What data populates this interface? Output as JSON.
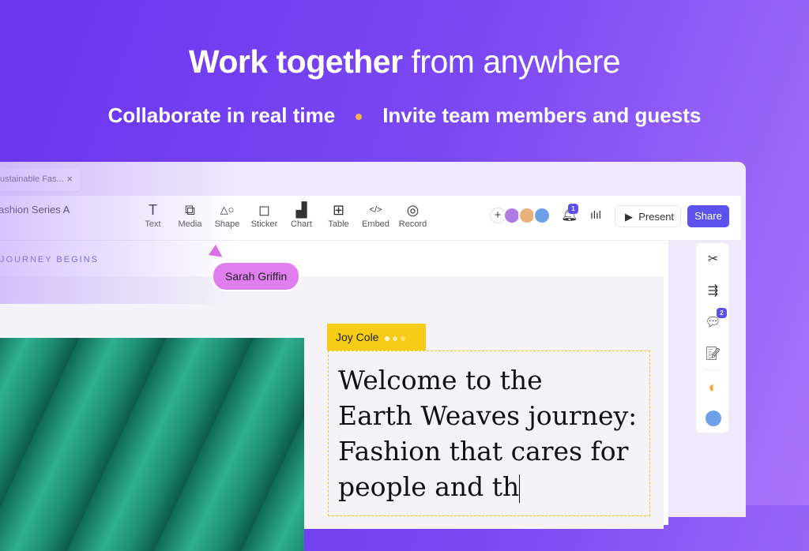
{
  "hero": {
    "title_bold": "Work together",
    "title_light": "from anywhere",
    "sub_left": "Collaborate in real time",
    "sub_right": "Invite team members and guests"
  },
  "tab": {
    "label": "ustainable Fas...",
    "close": "×"
  },
  "doc": {
    "title": "ashion Series A"
  },
  "tools": [
    {
      "icon": "T",
      "label": "Text"
    },
    {
      "icon": "⧉",
      "label": "Media"
    },
    {
      "icon": "△○",
      "label": "Shape"
    },
    {
      "icon": "◻",
      "label": "Sticker"
    },
    {
      "icon": "▟",
      "label": "Chart"
    },
    {
      "icon": "⊞",
      "label": "Table"
    },
    {
      "icon": "</>",
      "label": "Embed"
    },
    {
      "icon": "◎",
      "label": "Record"
    }
  ],
  "header": {
    "plus": "+",
    "notifications": "1",
    "present": "Present",
    "share": "Share"
  },
  "canvas": {
    "section": "JOURNEY BEGINS",
    "cursor_user": "Sarah Griffin",
    "editor_user": "Joy Cole",
    "text_lines": [
      "Welcome to the",
      "Earth Weaves journey:",
      "Fashion that cares for",
      "people and th"
    ]
  },
  "rail": {
    "comments_badge": "2"
  },
  "colors": {
    "accent": "#5e52ef",
    "sarah": "#e07ef0",
    "joy": "#f6cd16"
  }
}
